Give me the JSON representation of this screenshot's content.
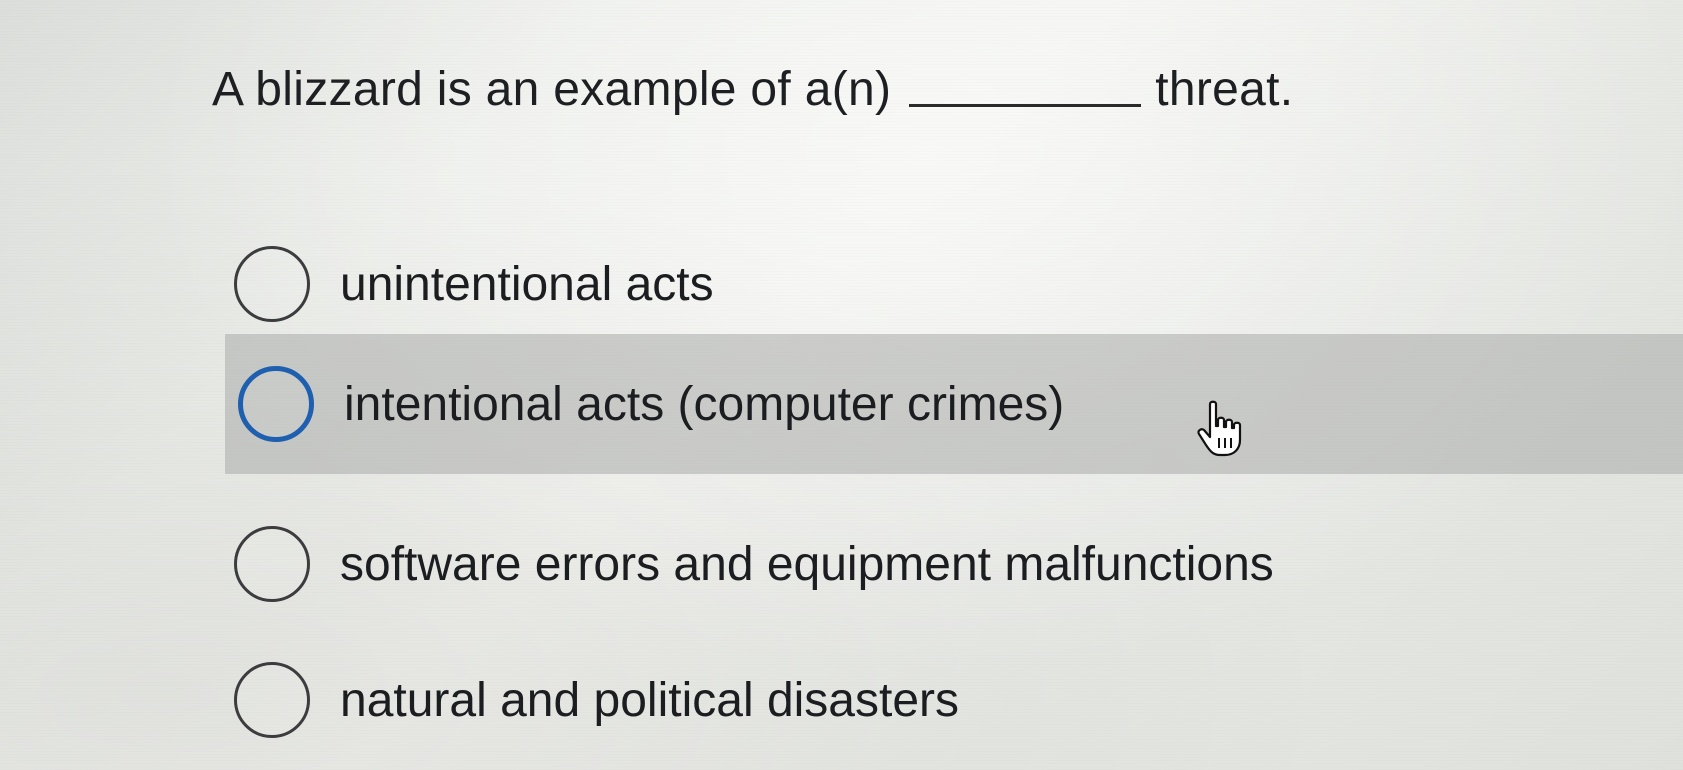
{
  "question": {
    "text_before": "A blizzard is an example of a(n)",
    "text_after": "threat."
  },
  "options": [
    {
      "label": "unintentional acts",
      "hovered": false
    },
    {
      "label": "intentional acts (computer crimes)",
      "hovered": true
    },
    {
      "label": "software errors and equipment malfunctions",
      "hovered": false
    },
    {
      "label": "natural and political disasters",
      "hovered": false
    }
  ],
  "cursor": {
    "icon": "pointing-hand-cursor-icon"
  },
  "colors": {
    "radio_hover_border": "#1f5fb0",
    "hover_row_background": "#aaacaa"
  }
}
